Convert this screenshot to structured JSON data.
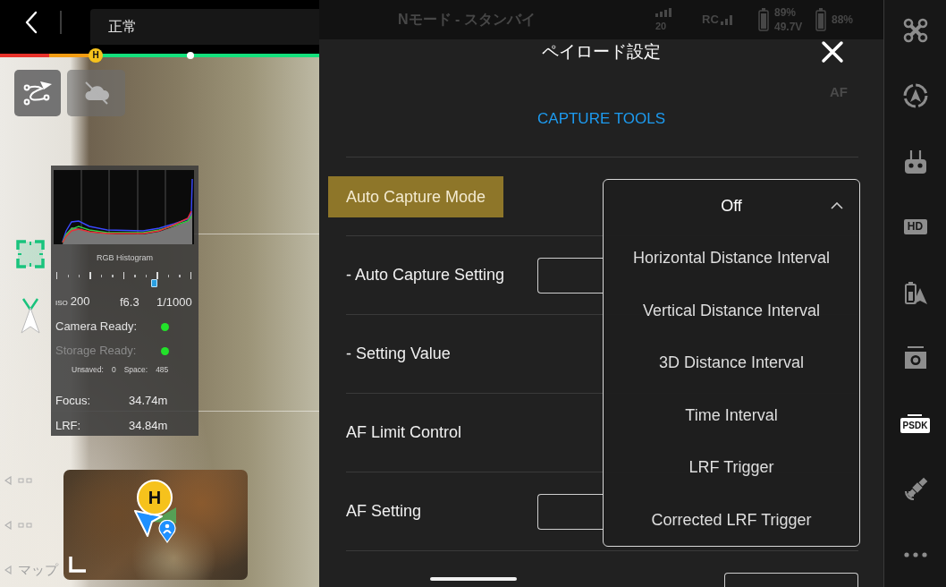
{
  "top_bar": {
    "status": "正常"
  },
  "flight_bar": {
    "home_marker": "H"
  },
  "histogram_panel": {
    "title": "RGB Histogram",
    "exposure_meter": {
      "level": 0.72
    },
    "iso_label": "ISO",
    "iso": "200",
    "aperture": "f6.3",
    "shutter": "1/1000",
    "statuses": [
      {
        "label": "Camera Ready:",
        "dimmed": false,
        "color": "#22e22a"
      },
      {
        "label": "Storage Ready:",
        "dimmed": true,
        "color": "#22e22a"
      }
    ],
    "storage": [
      {
        "label": "Unsaved:",
        "value": "0"
      },
      {
        "label": "Space:",
        "value": "485"
      }
    ],
    "readings": [
      {
        "label": "Focus:",
        "value": "34.74m"
      },
      {
        "label": "LRF:",
        "value": "34.84m"
      }
    ]
  },
  "map_toggle": {
    "label": "マップ"
  },
  "minimap": {
    "home_marker": "H"
  },
  "background_status": {
    "mode": "Nモード - スタンバイ",
    "satellites": "20",
    "rc_label": "RC",
    "batteries": [
      {
        "percent": "89%",
        "voltage": "49.7V"
      },
      {
        "percent": "88%"
      }
    ],
    "af_label": "AF"
  },
  "dialog": {
    "title": "ペイロード設定",
    "section": "CAPTURE TOOLS",
    "rows": [
      {
        "kind": "mode",
        "label": "Auto Capture Mode",
        "highlighted": true
      },
      {
        "kind": "select",
        "label": "- Auto Capture Setting",
        "highlighted": false
      },
      {
        "kind": "plain",
        "label": "- Setting Value",
        "highlighted": false
      },
      {
        "kind": "plain",
        "label": "AF Limit Control",
        "highlighted": false
      },
      {
        "kind": "select",
        "label": "AF Setting",
        "highlighted": false
      },
      {
        "kind": "value"
      }
    ],
    "dropdown": {
      "value": "Off",
      "expanded": true,
      "options": [
        {
          "label": "Horizontal Distance Interval",
          "selected": false
        },
        {
          "label": "Vertical Distance Interval",
          "selected": false
        },
        {
          "label": "3D Distance Interval",
          "selected": false
        },
        {
          "label": "Time Interval",
          "selected": false
        },
        {
          "label": "LRF Trigger",
          "selected": false
        },
        {
          "label": "Corrected LRF Trigger",
          "selected": false
        }
      ]
    }
  },
  "sidebar": {
    "items": [
      {
        "kind": "drone",
        "selected": false
      },
      {
        "kind": "navigation",
        "selected": false
      },
      {
        "kind": "controller",
        "selected": false
      },
      {
        "kind": "hd",
        "label": "HD",
        "selected": false
      },
      {
        "kind": "battery",
        "selected": false
      },
      {
        "kind": "camera",
        "selected": false
      },
      {
        "kind": "psdk",
        "label": "PSDK",
        "selected": true
      },
      {
        "kind": "satellite",
        "selected": false
      },
      {
        "kind": "more",
        "selected": false
      }
    ]
  }
}
